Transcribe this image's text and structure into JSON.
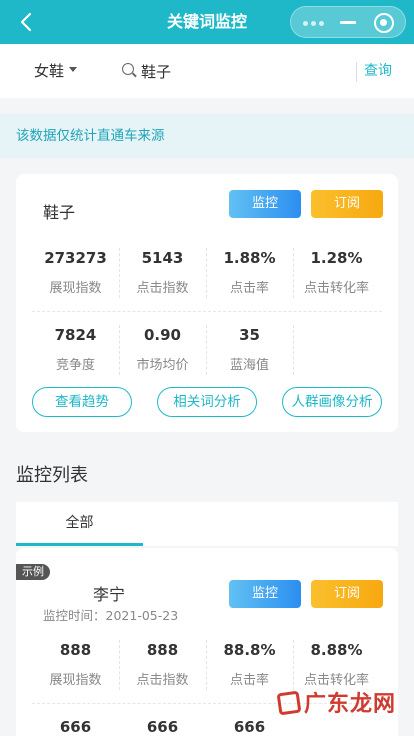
{
  "nav": {
    "title": "关键词监控"
  },
  "search": {
    "category": "女鞋",
    "query": "鞋子",
    "button": "查询"
  },
  "notice": "该数据仅统计直通车来源",
  "keyword_card": {
    "keyword": "鞋子",
    "monitor_label": "监控",
    "subscribe_label": "订阅",
    "stats_row1": [
      {
        "value": "273273",
        "label": "展现指数"
      },
      {
        "value": "5143",
        "label": "点击指数"
      },
      {
        "value": "1.88%",
        "label": "点击率"
      },
      {
        "value": "1.28%",
        "label": "点击转化率"
      }
    ],
    "stats_row2": [
      {
        "value": "7824",
        "label": "竞争度"
      },
      {
        "value": "0.90",
        "label": "市场均价"
      },
      {
        "value": "35",
        "label": "蓝海值"
      }
    ],
    "actions": [
      "查看趋势",
      "相关词分析",
      "人群画像分析"
    ]
  },
  "monitor_list": {
    "title": "监控列表",
    "tabs": [
      {
        "label": "全部"
      }
    ],
    "items": [
      {
        "badge": "示例",
        "keyword": "李宁",
        "time_label": "监控时间：",
        "time": "2021-05-23",
        "monitor_label": "监控",
        "subscribe_label": "订阅",
        "stats_row1": [
          {
            "value": "888",
            "label": "展现指数"
          },
          {
            "value": "888",
            "label": "点击指数"
          },
          {
            "value": "88.8%",
            "label": "点击率"
          },
          {
            "value": "8.88%",
            "label": "点击转化率"
          }
        ],
        "stats_row2": [
          {
            "value": "666"
          },
          {
            "value": "666"
          },
          {
            "value": "666"
          }
        ]
      }
    ]
  },
  "watermark": {
    "text": "广东龙网"
  },
  "colors": {
    "primary": "#1fb8c9",
    "monitor": "#2b8ef0",
    "subscribe": "#f7a810",
    "watermark": "#cf3b2f"
  }
}
